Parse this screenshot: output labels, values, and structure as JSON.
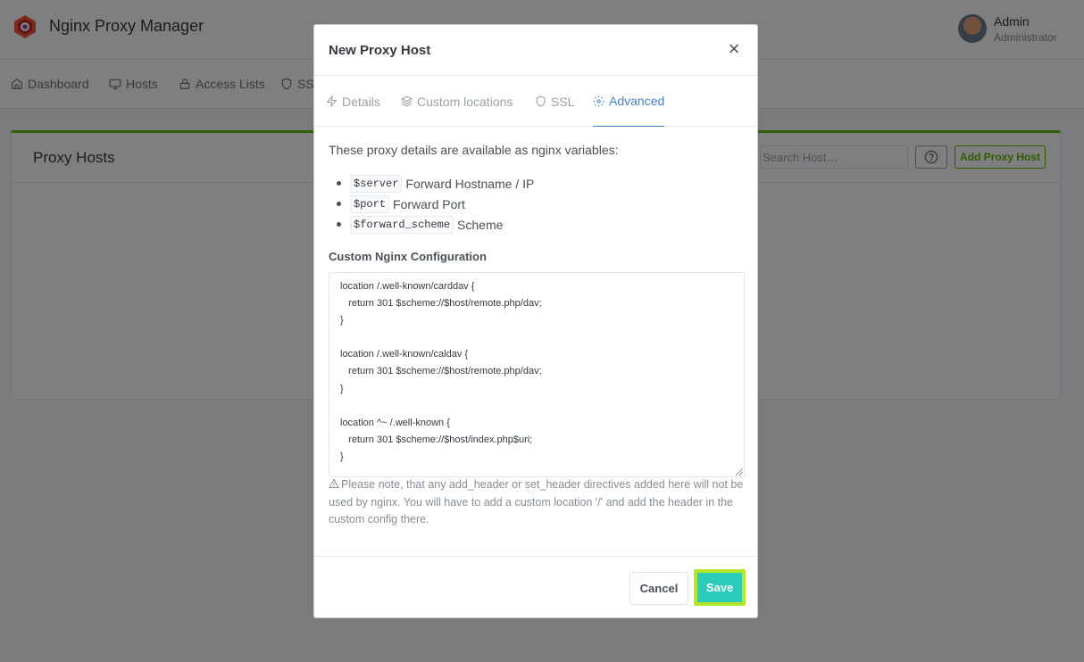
{
  "app": {
    "title": "Nginx Proxy Manager",
    "user_name": "Admin",
    "user_role": "Administrator"
  },
  "nav": {
    "items": [
      {
        "label": "Dashboard",
        "icon": "home-icon"
      },
      {
        "label": "Hosts",
        "icon": "monitor-icon"
      },
      {
        "label": "Access Lists",
        "icon": "lock-icon"
      },
      {
        "label": "SSL",
        "icon": "shield-icon"
      }
    ]
  },
  "card": {
    "title": "Proxy Hosts",
    "search_placeholder": "Search Host…",
    "help_icon": "help-circle-icon",
    "add_label": "Add Proxy Host",
    "accent_color": "#5eba00"
  },
  "modal": {
    "title": "New Proxy Host",
    "close_label": "×",
    "tabs": [
      {
        "label": "Details",
        "icon": "zap-icon",
        "active": false
      },
      {
        "label": "Custom locations",
        "icon": "layers-icon",
        "active": false
      },
      {
        "label": "SSL",
        "icon": "shield-icon",
        "active": false
      },
      {
        "label": "Advanced",
        "icon": "settings-icon",
        "active": true
      }
    ],
    "intro": "These proxy details are available as nginx variables:",
    "variables": [
      {
        "code": "$server",
        "desc": "Forward Hostname / IP"
      },
      {
        "code": "$port",
        "desc": "Forward Port"
      },
      {
        "code": "$forward_scheme",
        "desc": "Scheme"
      }
    ],
    "config_label": "Custom Nginx Configuration",
    "config_value": "location /.well-known/carddav {\n   return 301 $scheme://$host/remote.php/dav;\n}\n\nlocation /.well-known/caldav {\n   return 301 $scheme://$host/remote.php/dav;\n}\n\nlocation ^~ /.well-known {\n   return 301 $scheme://$host/index.php$uri;\n}",
    "note": "Please note, that any add_header or set_header directives added here will not be used by nginx. You will have to add a custom location '/' and add the header in the custom config there.",
    "cancel_label": "Cancel",
    "save_label": "Save",
    "active_tab_color": "#467fcf",
    "save_color": "#2dcbb9"
  }
}
